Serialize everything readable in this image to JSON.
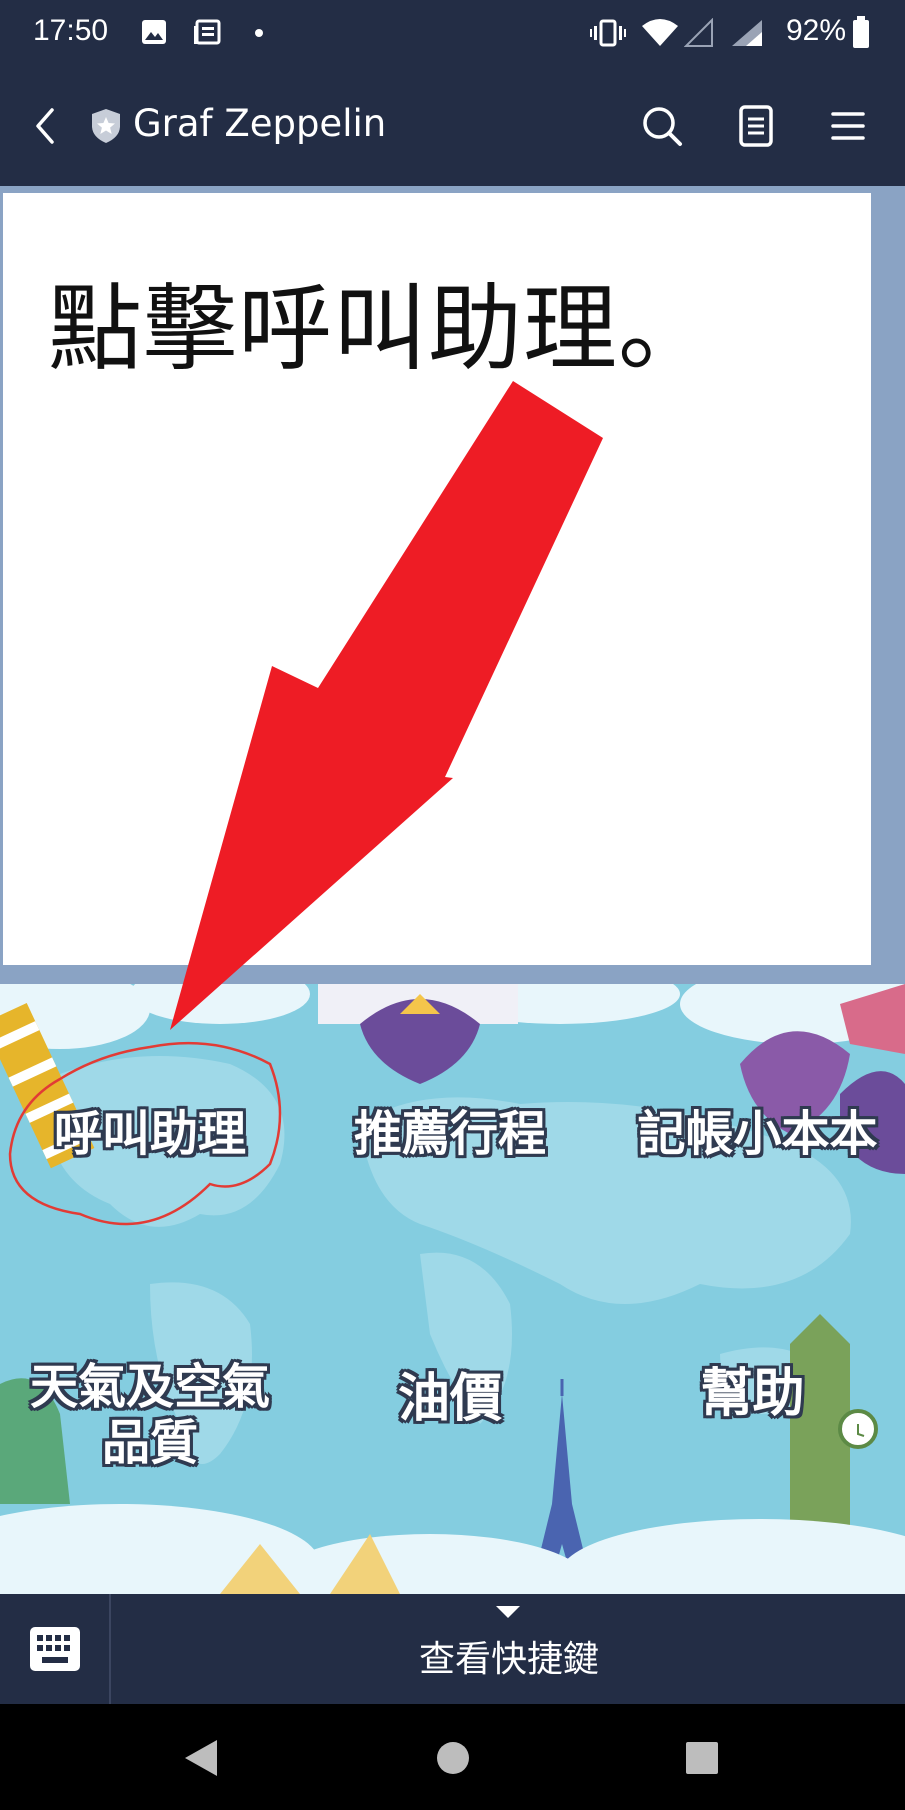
{
  "status_bar": {
    "time": "17:50",
    "battery": "92%",
    "icons": [
      "image-icon",
      "news-icon",
      "dot-icon",
      "vibrate-icon",
      "wifi-icon",
      "signal-icon",
      "signal-icon",
      "battery-icon"
    ]
  },
  "header": {
    "title": "Graf Zeppelin",
    "icons": [
      "back-icon",
      "shield-star-icon",
      "search-icon",
      "notes-icon",
      "menu-icon"
    ]
  },
  "chat": {
    "message": "點擊呼叫助理。"
  },
  "rich_menu": {
    "items": [
      {
        "label": "呼叫助理"
      },
      {
        "label": "推薦行程"
      },
      {
        "label": "記帳小本本"
      },
      {
        "label": "天氣及空氣品質"
      },
      {
        "label": "油價"
      },
      {
        "label": "幫助"
      }
    ],
    "weather_line1": "天氣及空氣",
    "weather_line2": "品質"
  },
  "bottom_bar": {
    "shortcut_label": "查看快捷鍵"
  },
  "colors": {
    "header_bg": "#232d45",
    "chat_bg": "#8aa3c4",
    "arrow": "#ee1c25",
    "menu_bg": "#84cde0"
  }
}
